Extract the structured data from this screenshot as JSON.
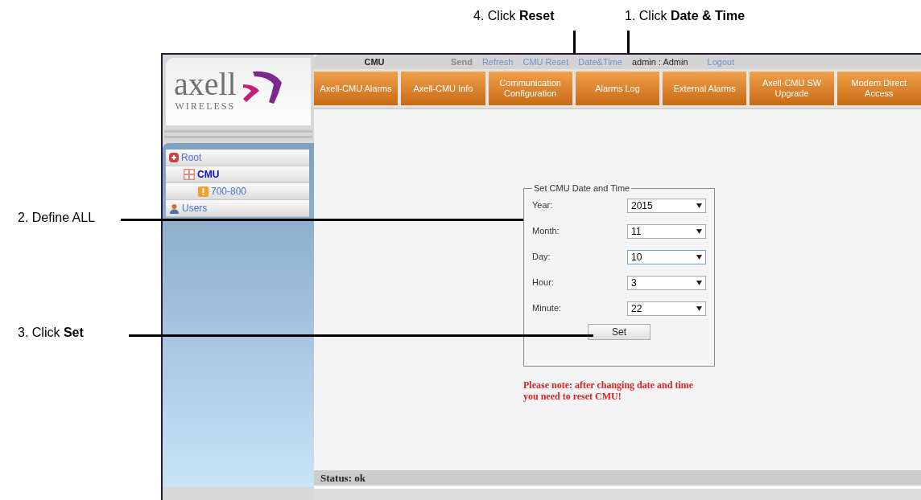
{
  "callouts": [
    {
      "text": "4. Click **Reset**"
    },
    {
      "text": "1. Click **Date & Time**"
    },
    {
      "text": "2. Define ALL"
    },
    {
      "text": "3. Click **Set**"
    }
  ],
  "logo": {
    "name": "axell",
    "tagline": "WIRELESS"
  },
  "tree": [
    {
      "label": "Root",
      "kind": "root",
      "selected": false,
      "children": [
        {
          "label": "CMU",
          "kind": "unit",
          "selected": true,
          "children": [
            {
              "label": "700-800",
              "kind": "alarm",
              "selected": false
            }
          ]
        }
      ]
    },
    {
      "label": "Users",
      "kind": "users",
      "selected": false
    }
  ],
  "top_bar": {
    "title": "CMU",
    "links": [
      {
        "label": "Send",
        "disabled": true
      },
      {
        "label": "Refresh",
        "disabled": false
      },
      {
        "label": "CMU Reset",
        "disabled": false
      },
      {
        "label": "Date&Time",
        "disabled": false
      }
    ],
    "user": "admin : Admin",
    "logout": "Logout"
  },
  "tabs": [
    {
      "label": "Axell-CMU Alarms",
      "selected": false
    },
    {
      "label": "Axell-CMU Info",
      "selected": false
    },
    {
      "label": "Communication Configuration",
      "selected": false
    },
    {
      "label": "Alarms Log",
      "selected": false
    },
    {
      "label": "External Alarms",
      "selected": false
    },
    {
      "label": "Axell-CMU SW Upgrade",
      "selected": false
    },
    {
      "label": "Modem Direct Access",
      "selected": false
    }
  ],
  "form": {
    "legend": "Set CMU Date and Time",
    "fields": [
      {
        "label": "Year:",
        "value": "2015",
        "focused": false
      },
      {
        "label": "Month:",
        "value": "11",
        "focused": false
      },
      {
        "label": "Day:",
        "value": "10",
        "focused": true
      },
      {
        "label": "Hour:",
        "value": "3",
        "focused": false
      },
      {
        "label": "Minute:",
        "value": "22",
        "focused": false
      }
    ],
    "button": "Set"
  },
  "note": "Please note: after changing date and time you need to reset CMU!",
  "status_bar": "Status: ok"
}
